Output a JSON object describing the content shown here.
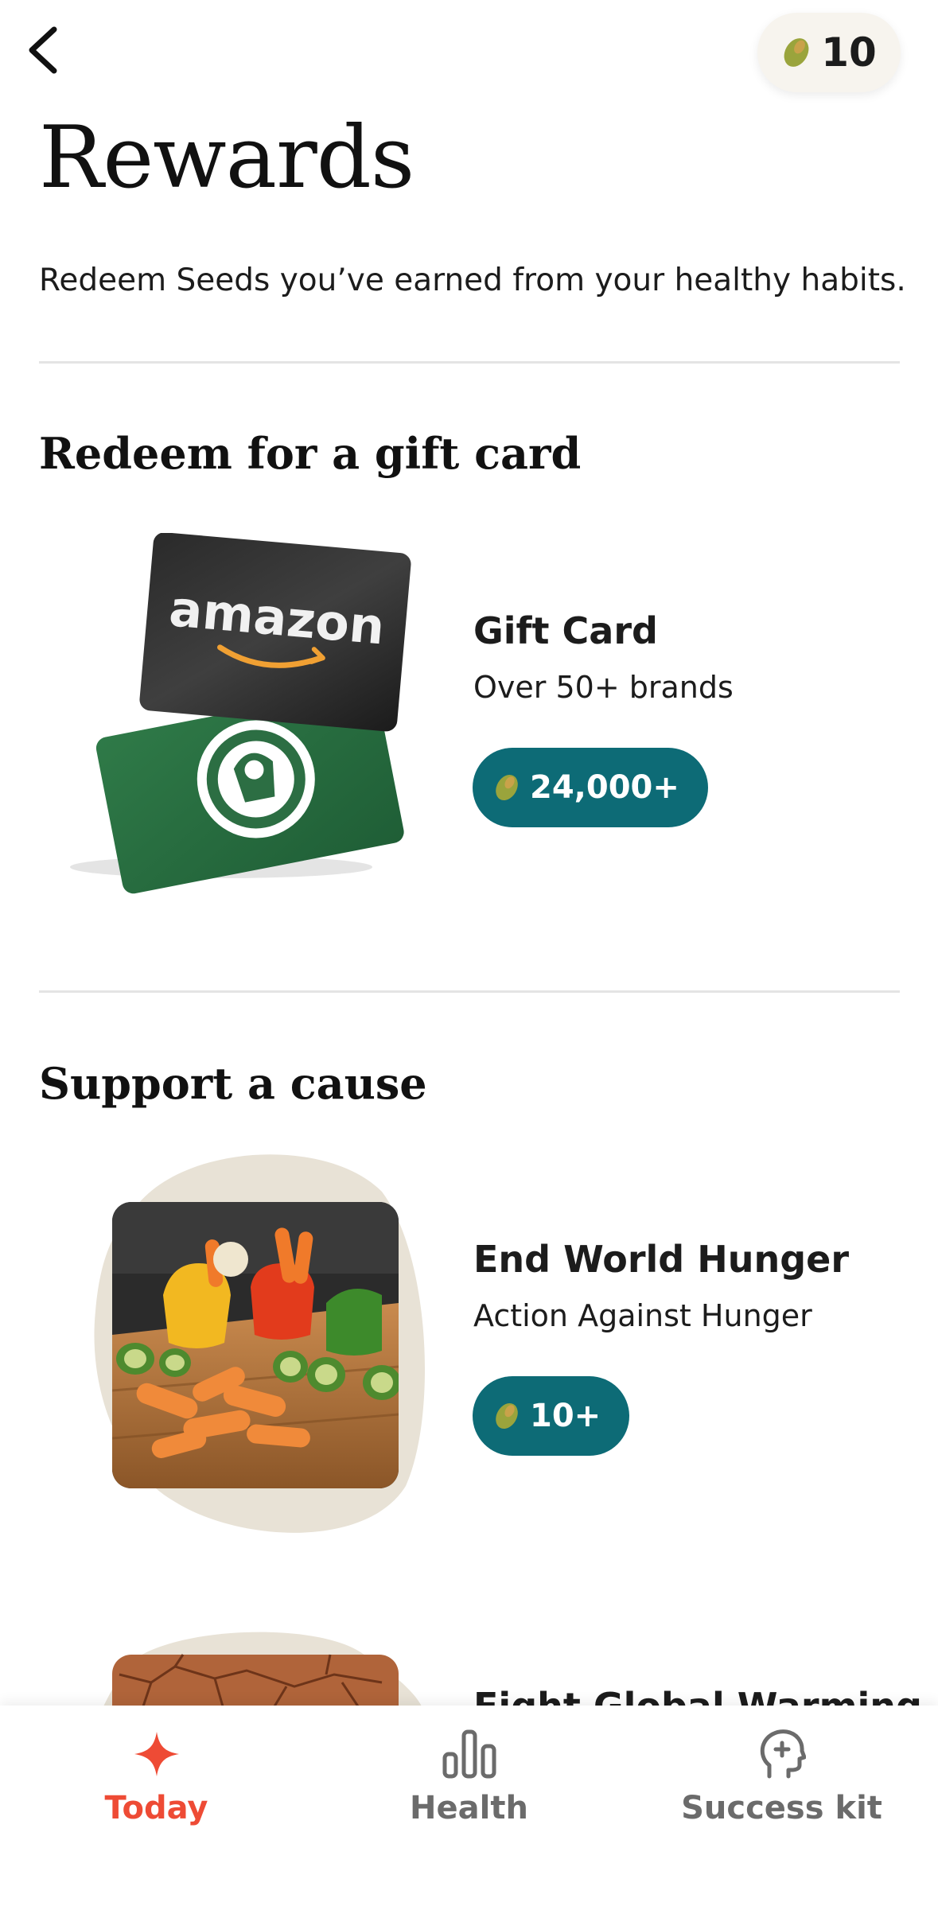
{
  "header": {
    "back_icon": "chevron-left-icon",
    "seed_count": "10",
    "seed_icon": "seed-icon"
  },
  "page": {
    "title": "Rewards",
    "subtitle": "Redeem Seeds you’ve earned from your healthy habits."
  },
  "sections": {
    "gift": {
      "title": "Redeem for a gift card",
      "item": {
        "title": "Gift Card",
        "subtitle": "Over 50+ brands",
        "cost": "24,000+",
        "card_brand": "amazon"
      }
    },
    "cause": {
      "title": "Support a cause",
      "items": [
        {
          "title": "End World Hunger",
          "subtitle": "Action Against Hunger",
          "cost": "10+"
        },
        {
          "title": "Fight Global Warming"
        }
      ]
    }
  },
  "tabbar": {
    "tabs": [
      {
        "label": "Today",
        "icon": "sparkle-icon",
        "active": true
      },
      {
        "label": "Health",
        "icon": "bar-chart-icon",
        "active": false
      },
      {
        "label": "Success kit",
        "icon": "head-plus-icon",
        "active": false
      }
    ]
  },
  "colors": {
    "accent_active": "#ee4b35",
    "pill_teal": "#0d6b76",
    "tab_inactive": "#6b6b6b",
    "seed_green": "#8a9a3a",
    "blob_beige": "#e8e2d6"
  }
}
